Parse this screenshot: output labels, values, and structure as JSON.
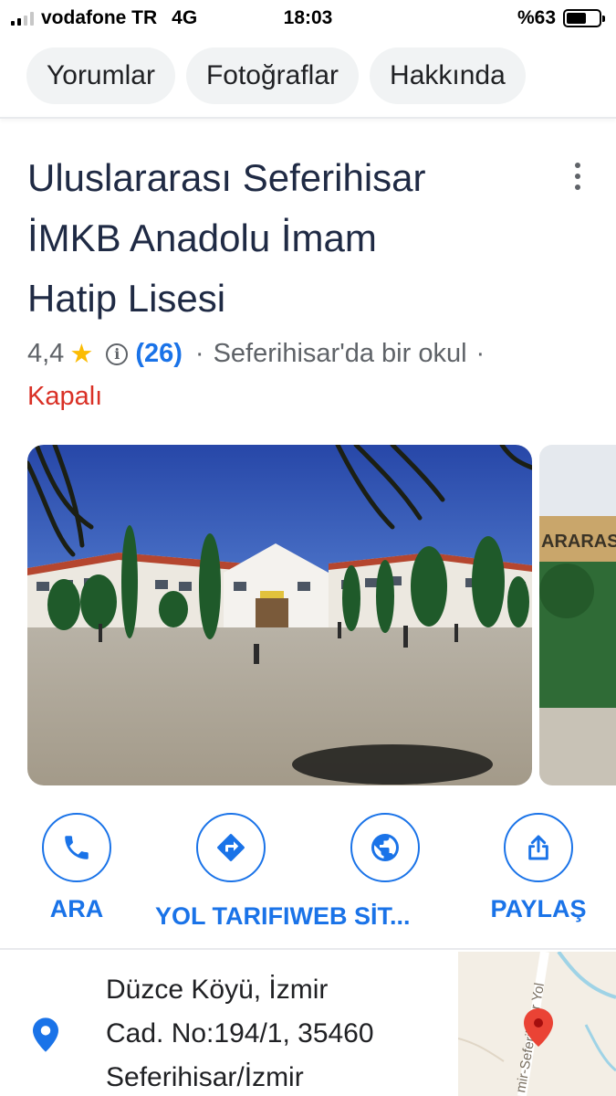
{
  "status_bar": {
    "carrier": "vodafone TR",
    "network": "4G",
    "time": "18:03",
    "battery": "%63",
    "battery_level": 0.63
  },
  "tabs": [
    {
      "label": "Yorumlar"
    },
    {
      "label": "Fotoğraflar"
    },
    {
      "label": "Hakkında"
    }
  ],
  "place": {
    "title_lines": [
      "Uluslararası Seferihisar",
      "İMKB Anadolu İmam",
      "Hatip Lisesi"
    ],
    "rating": "4,4",
    "review_count": "(26)",
    "separator": "·",
    "category": "Seferihisar'da bir okul",
    "status": "Kapalı"
  },
  "actions": [
    {
      "label": "ARA",
      "icon": "phone-icon"
    },
    {
      "label": "YOL TARIFI",
      "icon": "directions-icon"
    },
    {
      "label": "WEB SİT...",
      "icon": "globe-icon"
    },
    {
      "label": "PAYLAŞ",
      "icon": "share-icon"
    }
  ],
  "address": {
    "lines": [
      "Düzce Köyü, İzmir",
      "Cad. No:194/1, 35460",
      "Seferihisar/İzmir"
    ],
    "map_road_label": "mir-Seferihisar Yol"
  },
  "colors": {
    "accent_blue": "#1a73e8",
    "closed_red": "#d93025",
    "star_yellow": "#fbbc04",
    "title_color": "#1f2a44"
  }
}
